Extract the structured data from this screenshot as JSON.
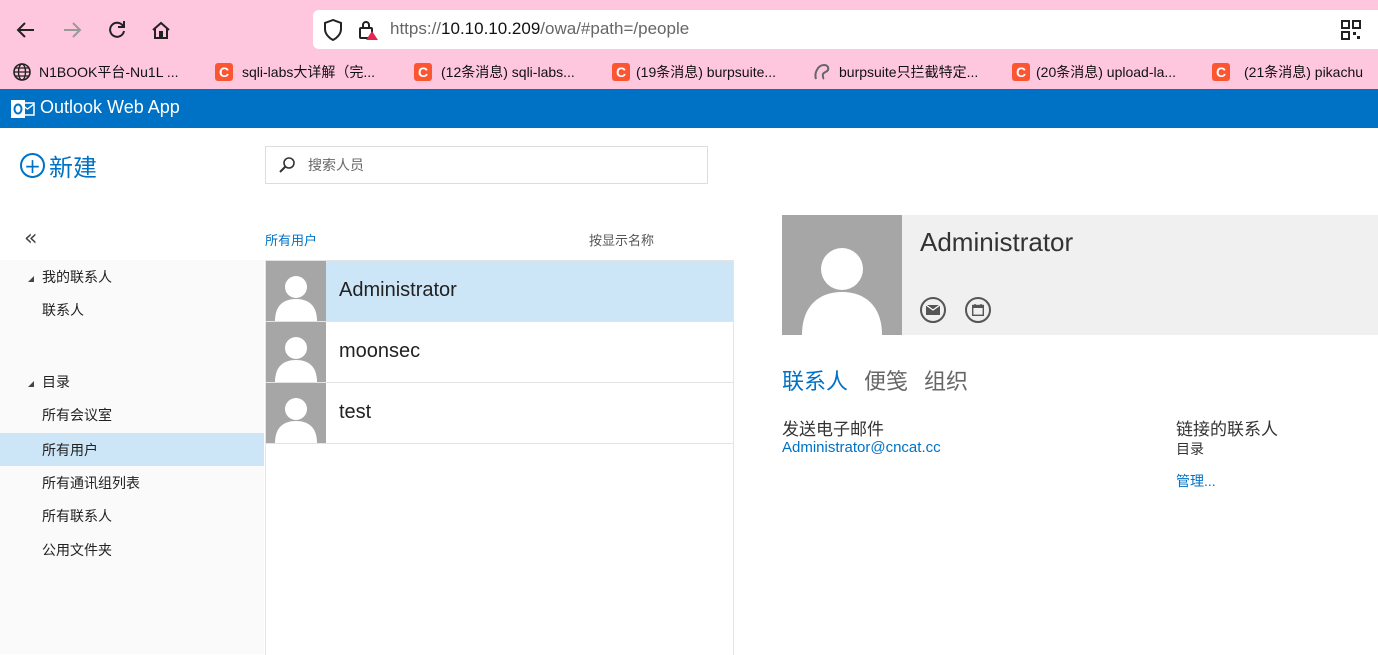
{
  "browser": {
    "url_prefix": "https://",
    "url_host": "10.10.10.209",
    "url_path": "/owa/#path=/people",
    "bookmarks": [
      {
        "label": "N1BOOK平台-Nu1L ...",
        "icon": "globe-icon"
      },
      {
        "label": "sqli-labs大详解（完...",
        "icon": "csdn-icon"
      },
      {
        "label": "(12条消息) sqli-labs...",
        "icon": "csdn-icon"
      },
      {
        "label": "(19条消息) burpsuite...",
        "icon": "csdn-icon"
      },
      {
        "label": "burpsuite只拦截特定...",
        "icon": "mascot-icon"
      },
      {
        "label": "(20条消息) upload-la...",
        "icon": "csdn-icon"
      },
      {
        "label": "(21条消息) pikachu",
        "icon": "csdn-icon"
      }
    ],
    "csdn_letter": "C"
  },
  "app": {
    "title": "Outlook Web App",
    "new_label": "新建",
    "collapse_glyph": "«"
  },
  "sidebar": {
    "groups": [
      {
        "label": "我的联系人",
        "items": [
          "联系人"
        ]
      },
      {
        "label": "目录",
        "items": [
          "所有会议室",
          "所有用户",
          "所有通讯组列表",
          "所有联系人",
          "公用文件夹"
        ]
      }
    ],
    "selected": "所有用户"
  },
  "search": {
    "placeholder": "搜索人员"
  },
  "list": {
    "filter_label": "所有用户",
    "sort_label": "按显示名称",
    "people": [
      {
        "name": "Administrator",
        "selected": true
      },
      {
        "name": "moonsec",
        "selected": false
      },
      {
        "name": "test",
        "selected": false
      }
    ]
  },
  "detail": {
    "name": "Administrator",
    "tabs": [
      "联系人",
      "便笺",
      "组织"
    ],
    "active_tab": "联系人",
    "email_label": "发送电子邮件",
    "email_value": "Administrator@cncat.cc",
    "linked_label": "链接的联系人",
    "linked_value": "目录",
    "manage_link": "管理..."
  },
  "colors": {
    "accent": "#0072c6",
    "browser_bar": "#ffc7de",
    "selected_bg": "#cde6f7"
  }
}
